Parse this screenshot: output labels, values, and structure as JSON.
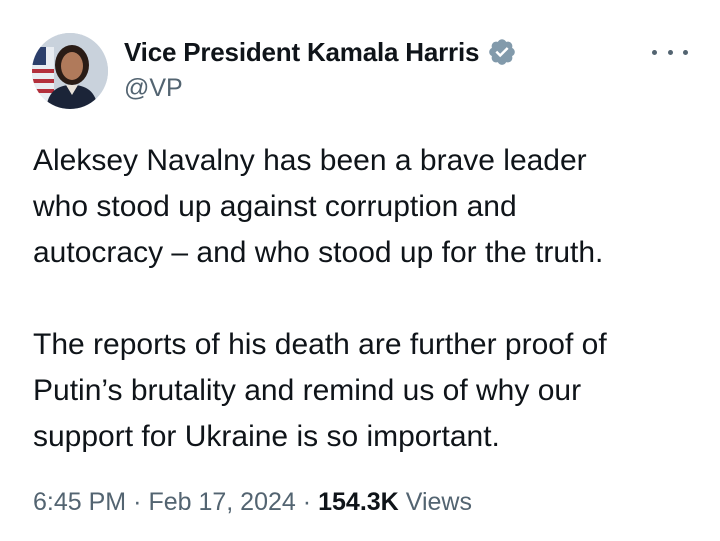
{
  "author": {
    "display_name": "Vice President Kamala Harris",
    "handle": "@VP",
    "avatar_icon": "profile-photo",
    "verified_icon": "verified-badge-icon",
    "verified_color": "#829aab"
  },
  "menu": {
    "icon": "more-options-icon"
  },
  "tweet": {
    "paragraph_1": "Aleksey Navalny has been a brave leader\nwho stood up against corruption and\nautocracy – and who stood up for the truth.",
    "paragraph_2": "The reports of his death are further proof of\nPutin’s brutality and remind us of why our\nsupport for Ukraine is so important."
  },
  "meta": {
    "time": "6:45 PM",
    "separator_1": "·",
    "date": "Feb 17, 2024",
    "separator_2": "·",
    "views_count": "154.3K",
    "views_label": "Views"
  },
  "colors": {
    "text_primary": "#0f1419",
    "text_secondary": "#536471"
  }
}
